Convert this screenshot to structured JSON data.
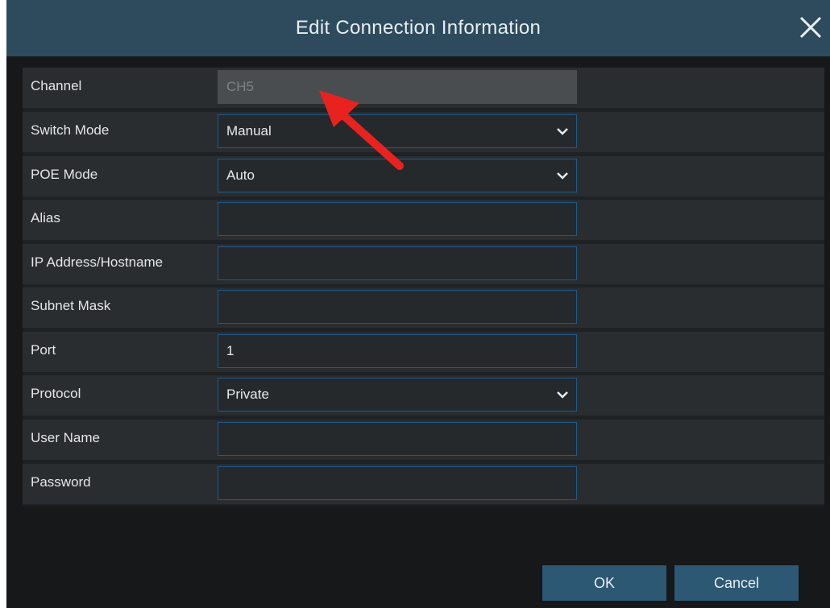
{
  "dialog": {
    "title": "Edit Connection Information",
    "close_icon": "close-icon"
  },
  "form": {
    "channel": {
      "label": "Channel",
      "value": "CH5"
    },
    "switch_mode": {
      "label": "Switch Mode",
      "value": "Manual"
    },
    "poe_mode": {
      "label": "POE Mode",
      "value": "Auto"
    },
    "alias": {
      "label": "Alias",
      "value": ""
    },
    "ip_address": {
      "label": "IP Address/Hostname",
      "value": ""
    },
    "subnet_mask": {
      "label": "Subnet Mask",
      "value": ""
    },
    "port": {
      "label": "Port",
      "value": "1"
    },
    "protocol": {
      "label": "Protocol",
      "value": "Private"
    },
    "user_name": {
      "label": "User Name",
      "value": ""
    },
    "password": {
      "label": "Password",
      "value": ""
    }
  },
  "buttons": {
    "ok": "OK",
    "cancel": "Cancel"
  },
  "annotation": {
    "arrow_icon": "red-arrow-icon",
    "arrow_color": "#e8231f"
  },
  "colors": {
    "titlebar": "#2d4b5d",
    "background": "#16181a",
    "row": "#2a2d30",
    "field_border": "#1f5a8a",
    "button": "#2d5874"
  }
}
